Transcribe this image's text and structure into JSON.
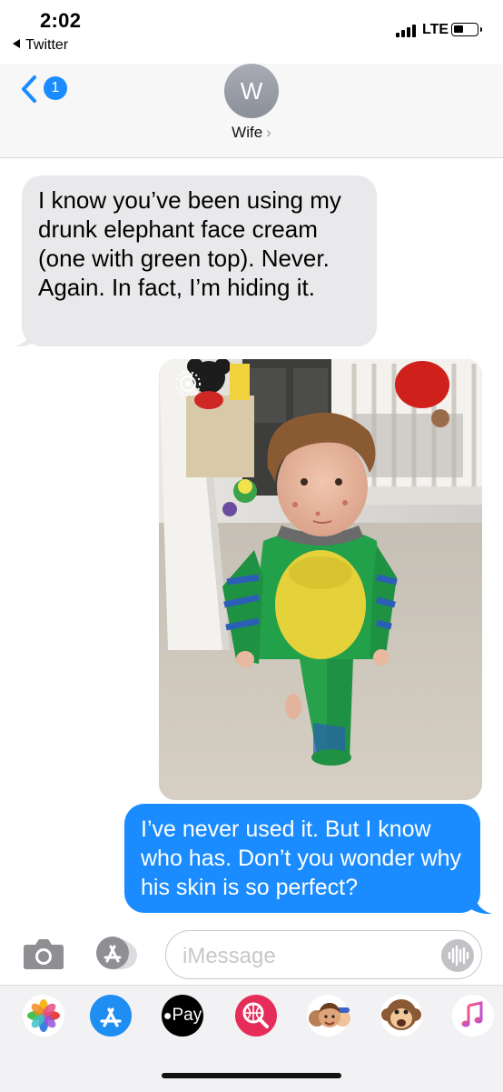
{
  "status_bar": {
    "time": "2:02",
    "back_app": "Twitter",
    "network": "LTE"
  },
  "header": {
    "unread_count": "1",
    "avatar_initial": "W",
    "contact_name": "Wife",
    "chevron": "›"
  },
  "messages": [
    {
      "direction": "incoming",
      "text": "I know you’ve been using my drunk elephant face cream (one with green top). Never. Again. In fact, I’m hiding it."
    },
    {
      "direction": "outgoing",
      "type": "photo",
      "icon": "live-photo-icon"
    },
    {
      "direction": "outgoing",
      "text": "I’ve never used it. But I know who has. Don’t you wonder why his skin is so perfect?"
    }
  ],
  "compose": {
    "placeholder": "iMessage"
  },
  "app_tray": {
    "apple_pay_label": "Pay",
    "apps": [
      "photos-icon",
      "app-store-icon",
      "apple-pay-icon",
      "web-images-icon",
      "memoji-icon",
      "animoji-monkey-icon",
      "music-icon"
    ]
  },
  "colors": {
    "outgoing_bubble": "#1a8cff",
    "incoming_bubble": "#e9e9eb",
    "header_bg": "#f7f7f7",
    "tray_bg": "#f2f2f4"
  }
}
